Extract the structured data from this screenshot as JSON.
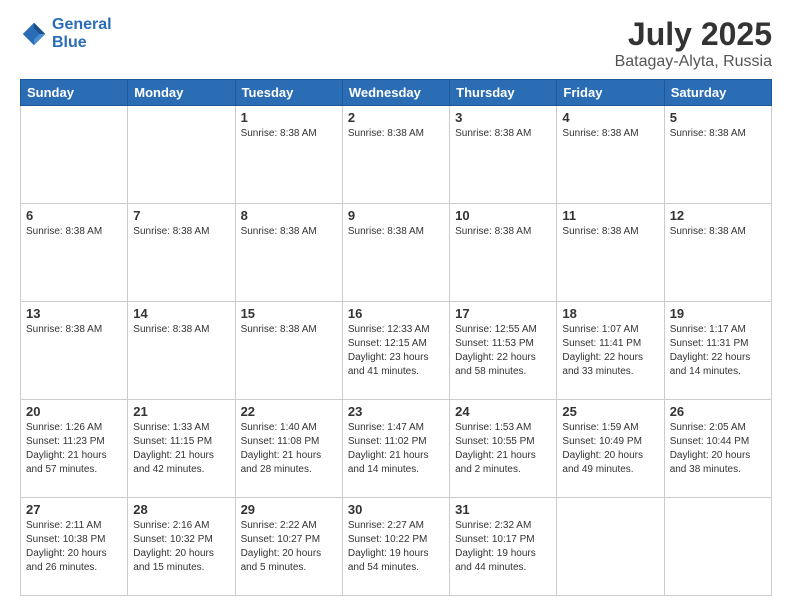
{
  "logo": {
    "line1": "General",
    "line2": "Blue"
  },
  "title": {
    "month_year": "July 2025",
    "location": "Batagay-Alyta, Russia"
  },
  "weekdays": [
    "Sunday",
    "Monday",
    "Tuesday",
    "Wednesday",
    "Thursday",
    "Friday",
    "Saturday"
  ],
  "weeks": [
    [
      {
        "day": "",
        "info": ""
      },
      {
        "day": "",
        "info": ""
      },
      {
        "day": "1",
        "info": "Sunrise: 8:38 AM"
      },
      {
        "day": "2",
        "info": "Sunrise: 8:38 AM"
      },
      {
        "day": "3",
        "info": "Sunrise: 8:38 AM"
      },
      {
        "day": "4",
        "info": "Sunrise: 8:38 AM"
      },
      {
        "day": "5",
        "info": "Sunrise: 8:38 AM"
      }
    ],
    [
      {
        "day": "6",
        "info": "Sunrise: 8:38 AM"
      },
      {
        "day": "7",
        "info": "Sunrise: 8:38 AM"
      },
      {
        "day": "8",
        "info": "Sunrise: 8:38 AM"
      },
      {
        "day": "9",
        "info": "Sunrise: 8:38 AM"
      },
      {
        "day": "10",
        "info": "Sunrise: 8:38 AM"
      },
      {
        "day": "11",
        "info": "Sunrise: 8:38 AM"
      },
      {
        "day": "12",
        "info": "Sunrise: 8:38 AM"
      }
    ],
    [
      {
        "day": "13",
        "info": "Sunrise: 8:38 AM"
      },
      {
        "day": "14",
        "info": "Sunrise: 8:38 AM"
      },
      {
        "day": "15",
        "info": "Sunrise: 8:38 AM"
      },
      {
        "day": "16",
        "info": "Sunrise: 12:33 AM\nSunset: 12:15 AM\nDaylight: 23 hours and 41 minutes."
      },
      {
        "day": "17",
        "info": "Sunrise: 12:55 AM\nSunset: 11:53 PM\nDaylight: 22 hours and 58 minutes."
      },
      {
        "day": "18",
        "info": "Sunrise: 1:07 AM\nSunset: 11:41 PM\nDaylight: 22 hours and 33 minutes."
      },
      {
        "day": "19",
        "info": "Sunrise: 1:17 AM\nSunset: 11:31 PM\nDaylight: 22 hours and 14 minutes."
      }
    ],
    [
      {
        "day": "20",
        "info": "Sunrise: 1:26 AM\nSunset: 11:23 PM\nDaylight: 21 hours and 57 minutes."
      },
      {
        "day": "21",
        "info": "Sunrise: 1:33 AM\nSunset: 11:15 PM\nDaylight: 21 hours and 42 minutes."
      },
      {
        "day": "22",
        "info": "Sunrise: 1:40 AM\nSunset: 11:08 PM\nDaylight: 21 hours and 28 minutes."
      },
      {
        "day": "23",
        "info": "Sunrise: 1:47 AM\nSunset: 11:02 PM\nDaylight: 21 hours and 14 minutes."
      },
      {
        "day": "24",
        "info": "Sunrise: 1:53 AM\nSunset: 10:55 PM\nDaylight: 21 hours and 2 minutes."
      },
      {
        "day": "25",
        "info": "Sunrise: 1:59 AM\nSunset: 10:49 PM\nDaylight: 20 hours and 49 minutes."
      },
      {
        "day": "26",
        "info": "Sunrise: 2:05 AM\nSunset: 10:44 PM\nDaylight: 20 hours and 38 minutes."
      }
    ],
    [
      {
        "day": "27",
        "info": "Sunrise: 2:11 AM\nSunset: 10:38 PM\nDaylight: 20 hours and 26 minutes."
      },
      {
        "day": "28",
        "info": "Sunrise: 2:16 AM\nSunset: 10:32 PM\nDaylight: 20 hours and 15 minutes."
      },
      {
        "day": "29",
        "info": "Sunrise: 2:22 AM\nSunset: 10:27 PM\nDaylight: 20 hours and 5 minutes."
      },
      {
        "day": "30",
        "info": "Sunrise: 2:27 AM\nSunset: 10:22 PM\nDaylight: 19 hours and 54 minutes."
      },
      {
        "day": "31",
        "info": "Sunrise: 2:32 AM\nSunset: 10:17 PM\nDaylight: 19 hours and 44 minutes."
      },
      {
        "day": "",
        "info": ""
      },
      {
        "day": "",
        "info": ""
      }
    ]
  ]
}
